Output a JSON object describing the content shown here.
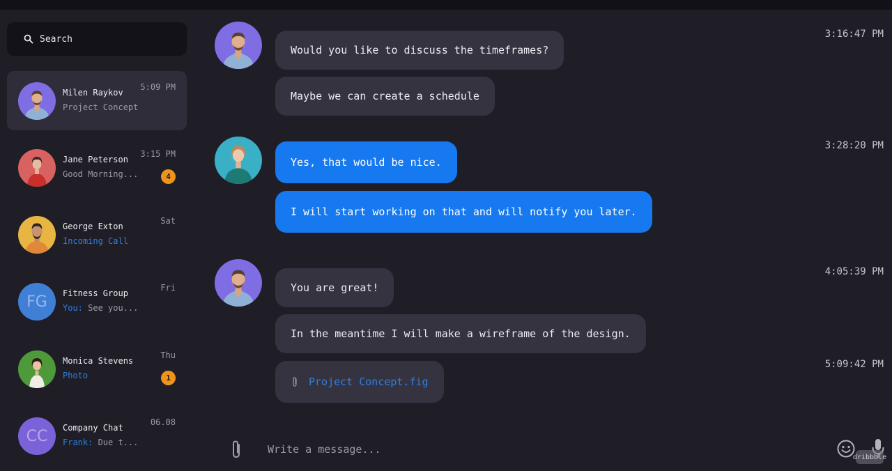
{
  "search": {
    "placeholder": "Search"
  },
  "chats": [
    {
      "name": "Milen Raykov",
      "preview": "Project Concept",
      "time": "5:09 PM",
      "active": true,
      "avatar": "photo-man-blue"
    },
    {
      "name": "Jane Peterson",
      "preview": "Good Morning...",
      "time": "3:15 PM",
      "badge": "4",
      "avatar": "photo-woman-red"
    },
    {
      "name": "George Exton",
      "preview": "Incoming Call",
      "preview_color": "blue",
      "time": "Sat",
      "avatar": "photo-man-yellow"
    },
    {
      "name": "Fitness Group",
      "preview_prefix": "You:",
      "preview": " See you...",
      "time": "Fri",
      "avatar_initials": "FG",
      "avatar_color": "#3f7fd6"
    },
    {
      "name": "Monica Stevens",
      "preview": "Photo",
      "preview_color": "blue",
      "time": "Thu",
      "badge": "1",
      "avatar": "photo-woman-green"
    },
    {
      "name": "Company Chat",
      "preview_prefix": "Frank:",
      "preview": " Due t...",
      "time": "06.08",
      "avatar_initials": "CC",
      "avatar_color": "#7b62d9"
    }
  ],
  "messages": [
    {
      "text": "Would you like to discuss the timeframes?",
      "style": "incoming"
    },
    {
      "text": "Maybe we can create a schedule",
      "style": "incoming"
    },
    {
      "text": "Yes, that would be nice.",
      "style": "outgoing"
    },
    {
      "text": "I will start working on that and will notify you later.",
      "style": "outgoing"
    },
    {
      "text": "You are great!",
      "style": "incoming"
    },
    {
      "text": "In the meantime I will make a wireframe of the design.",
      "style": "incoming"
    },
    {
      "file": "Project Concept.fig",
      "style": "incoming-file"
    }
  ],
  "timestamps": [
    "3:16:47 PM",
    "3:28:20 PM",
    "4:05:39 PM",
    "5:09:42 PM"
  ],
  "composer": {
    "placeholder": "Write a message..."
  },
  "watermark": "dribbble",
  "colors": {
    "accent": "#1679ef",
    "badge": "#f0931d",
    "background": "#1f1e27",
    "bubble": "#34333f"
  },
  "icons": [
    "search-icon",
    "paperclip-icon",
    "emoji-icon",
    "microphone-icon"
  ]
}
